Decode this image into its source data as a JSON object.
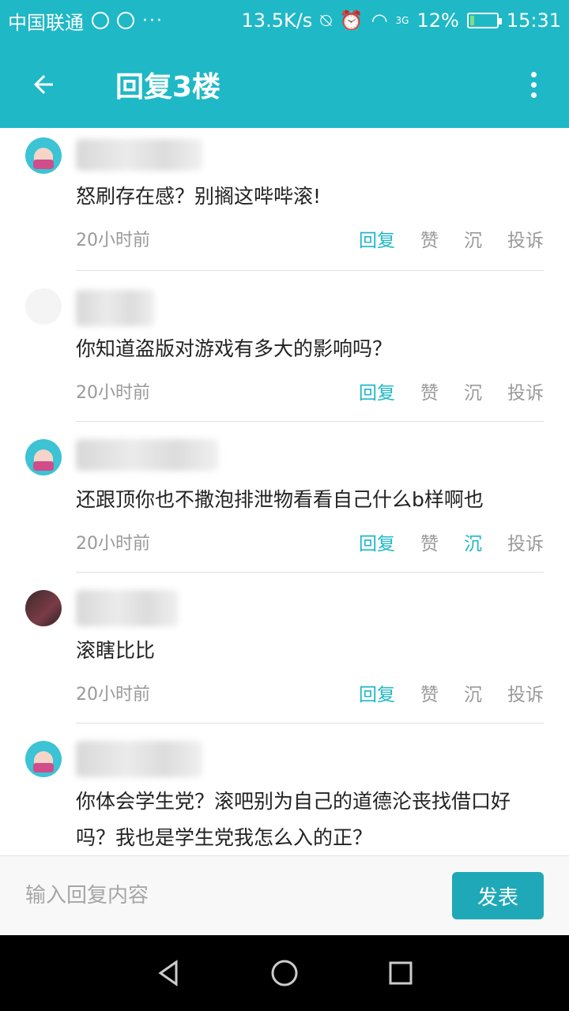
{
  "status_bar": {
    "carrier": "中国联通",
    "speed": "13.5K/s",
    "network": "3G",
    "battery": "12%",
    "time": "15:31"
  },
  "app_bar": {
    "title": "回复3楼"
  },
  "comments": [
    {
      "text": "怒刷存在感？别搁这哔哔滚!",
      "time": "20小时前",
      "reply": "回复",
      "like": "赞",
      "sink": "沉",
      "report": "投诉"
    },
    {
      "text": "你知道盗版对游戏有多大的影响吗？",
      "time": "20小时前",
      "reply": "回复",
      "like": "赞",
      "sink": "沉",
      "report": "投诉"
    },
    {
      "text": "还跟顶你也不撒泡排泄物看看自己什么b样啊也",
      "time": "20小时前",
      "reply": "回复",
      "like": "赞",
      "sink": "沉",
      "report": "投诉"
    },
    {
      "text": "滚瞎比比",
      "time": "20小时前",
      "reply": "回复",
      "like": "赞",
      "sink": "沉",
      "report": "投诉"
    },
    {
      "text": "你体会学生党？滚吧别为自己的道德沦丧找借口好吗？我也是学生党我怎么入的正？"
    }
  ],
  "input": {
    "placeholder": "输入回复内容",
    "send_label": "发表"
  },
  "colors": {
    "accent": "#1fb8c6",
    "button": "#1fa9b8"
  }
}
